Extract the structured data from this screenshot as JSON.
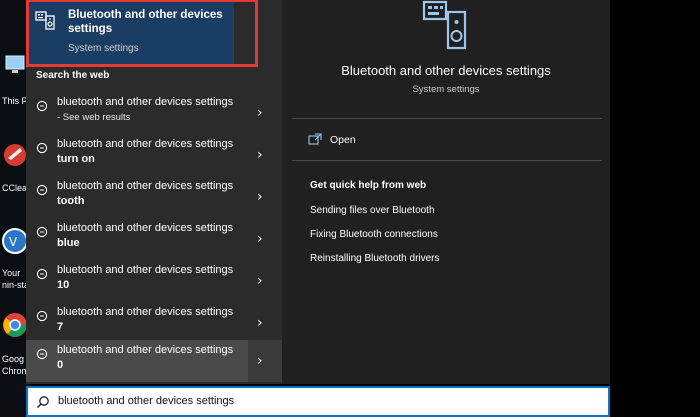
{
  "best_match": {
    "title": "Bluetooth and other devices settings",
    "subtitle": "System settings",
    "icon": "settings-device-icon"
  },
  "web_section_label": "Search the web",
  "results": [
    {
      "line1": "bluetooth and other devices settings",
      "line2": "- See web results",
      "style": "small"
    },
    {
      "line1": "bluetooth and other devices settings",
      "line2": "turn on",
      "style": "bold"
    },
    {
      "line1": "bluetooth and other devices settings",
      "line2": "tooth",
      "style": "bold"
    },
    {
      "line1": "bluetooth and other devices settings",
      "line2": "blue",
      "style": "bold"
    },
    {
      "line1": "bluetooth and other devices settings",
      "line2": "10",
      "style": "bold"
    },
    {
      "line1": "bluetooth and other devices settings",
      "line2": "7",
      "style": "bold"
    },
    {
      "line1": "bluetooth and other devices settings",
      "line2": "0",
      "style": "bold"
    }
  ],
  "detail": {
    "title": "Bluetooth and other devices settings",
    "subtitle": "System settings",
    "open_label": "Open",
    "help_heading": "Get quick help from web",
    "help_links": [
      "Sending files over Bluetooth",
      "Fixing Bluetooth connections",
      "Reinstalling Bluetooth drivers"
    ]
  },
  "search": {
    "query": "bluetooth and other devices settings"
  },
  "desktop_labels": [
    "This P",
    "CClear",
    "Your",
    "nin-sta",
    "Goog",
    "Chron"
  ],
  "colors": {
    "highlight": "#e53935",
    "best_match_bg": "#1b3d63",
    "search_border": "#0a72c9"
  }
}
